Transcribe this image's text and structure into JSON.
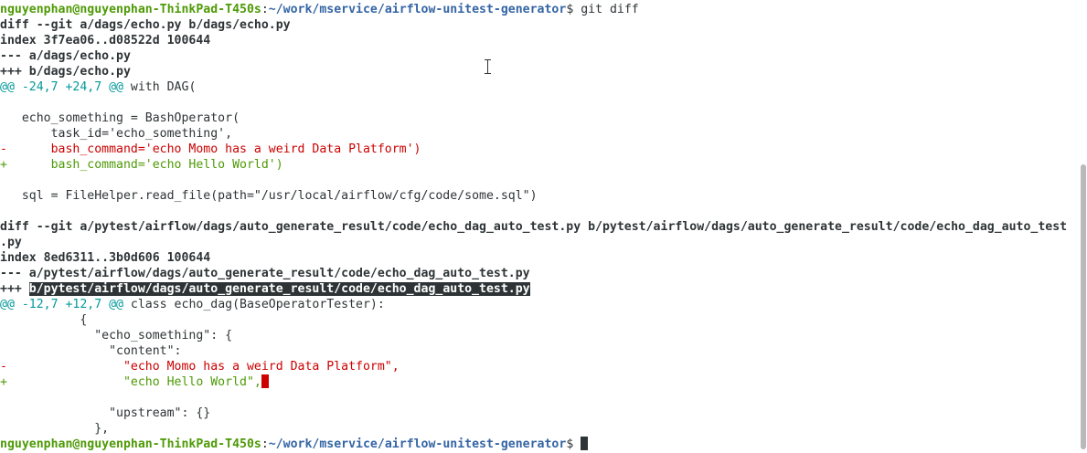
{
  "prompt": {
    "user_host": "nguyenphan@nguyenphan-ThinkPad-T450s",
    "separator": ":",
    "path": "~/work/mservice/airflow-unitest-generator",
    "symbol": "$ ",
    "command": "git diff"
  },
  "diff1": {
    "header": "diff --git a/dags/echo.py b/dags/echo.py",
    "index": "index 3f7ea06..d08522d 100644",
    "old_file": "--- a/dags/echo.py",
    "new_file": "+++ b/dags/echo.py",
    "hunk_marker": "@@ -24,7 +24,7 @@",
    "hunk_context": " with DAG(",
    "lines": [
      {
        "text": ""
      },
      {
        "text": "   echo_something = BashOperator("
      },
      {
        "text": "       task_id='echo_something',"
      },
      {
        "text": "-      bash_command='echo Momo has a weird Data Platform')"
      },
      {
        "text": "+      bash_command='echo Hello World')"
      },
      {
        "text": ""
      },
      {
        "text": "   sql = FileHelper.read_file(path=\"/usr/local/airflow/cfg/code/some.sql\")"
      },
      {
        "text": ""
      }
    ]
  },
  "diff2": {
    "header_line1": "diff --git a/pytest/airflow/dags/auto_generate_result/code/echo_dag_auto_test.py b/pytest/airflow/dags/auto_generate_result/code/echo_dag_auto_test",
    "header_line2": ".py",
    "index": "index 8ed6311..3b0d606 100644",
    "old_file": "--- a/pytest/airflow/dags/auto_generate_result/code/echo_dag_auto_test.py",
    "new_file_prefix": "+++ ",
    "new_file_selected": "b/pytest/airflow/dags/auto_generate_result/code/echo_dag_auto_test.py",
    "hunk_marker": "@@ -12,7 +12,7 @@",
    "hunk_context": " class echo_dag(BaseOperatorTester):",
    "lines": [
      {
        "text": "           {"
      },
      {
        "text": "             \"echo_something\": {"
      },
      {
        "text": "               \"content\":"
      },
      {
        "text": "-                \"echo Momo has a weird Data Platform\","
      },
      {
        "text": "+                \"echo Hello World\","
      },
      {
        "text": ""
      },
      {
        "text": "               \"upstream\": {}"
      },
      {
        "text": "             },"
      }
    ]
  },
  "colors": {
    "background": "#ffffff",
    "foreground": "#2e3436",
    "prompt_user": "#4e9a06",
    "prompt_path": "#3465a4",
    "removed": "#cc0000",
    "added": "#4e9a06",
    "hunk": "#06989a"
  }
}
